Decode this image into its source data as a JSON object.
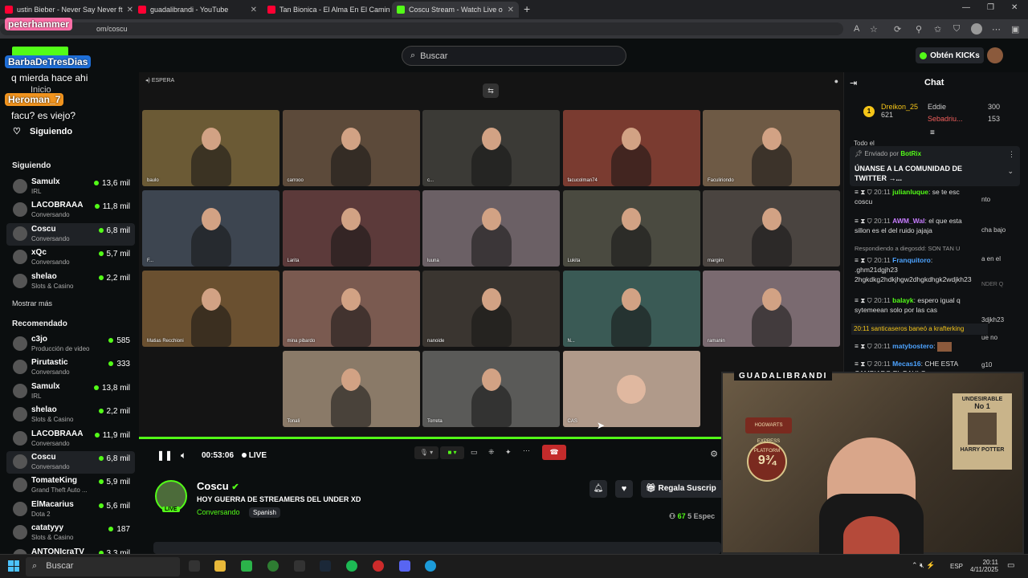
{
  "browser": {
    "tabs": [
      {
        "title": "ustin Bieber - Never Say Never ft",
        "color": "#ff0033"
      },
      {
        "title": "guadalibrandi - YouTube",
        "color": "#ff0033"
      },
      {
        "title": "Tan Bionica - El Alma En El Camin",
        "color": "#ff0033"
      },
      {
        "title": "Coscu Stream - Watch Live o",
        "color": "#53fc18"
      }
    ],
    "url": "om/coscu"
  },
  "header": {
    "search_placeholder": "Buscar",
    "get_kicks": "Obtén KICKs"
  },
  "overlay_chat": {
    "user1": "peterhammer",
    "user2": "BarbaDeTresDias",
    "msg1": "q mierda hace ahi",
    "user3": "Heroman_7",
    "msg2": "facu? es viejo?"
  },
  "sidebar": {
    "home": "Inicio",
    "following_link": "Siguiendo",
    "following_title": "Siguiendo",
    "following": [
      {
        "name": "Samulx",
        "sub": "IRL",
        "viewers": "13,6 mil"
      },
      {
        "name": "LACOBRAAA",
        "sub": "Conversando",
        "viewers": "11,8 mil"
      },
      {
        "name": "Coscu",
        "sub": "Conversando",
        "viewers": "6,8 mil"
      },
      {
        "name": "xQc",
        "sub": "Conversando",
        "viewers": "5,7 mil"
      },
      {
        "name": "shelao",
        "sub": "Slots & Casino",
        "viewers": "2,2 mil"
      }
    ],
    "show_more": "Mostrar más",
    "recommended_title": "Recomendado",
    "recommended": [
      {
        "name": "c3jo",
        "sub": "Producción de video",
        "viewers": "585"
      },
      {
        "name": "Pirutastic",
        "sub": "Conversando",
        "viewers": "333"
      },
      {
        "name": "Samulx",
        "sub": "IRL",
        "viewers": "13,8 mil"
      },
      {
        "name": "shelao",
        "sub": "Slots & Casino",
        "viewers": "2,2 mil"
      },
      {
        "name": "LACOBRAAA",
        "sub": "Conversando",
        "viewers": "11,9 mil"
      },
      {
        "name": "Coscu",
        "sub": "Conversando",
        "viewers": "6,8 mil"
      },
      {
        "name": "TomateKing",
        "sub": "Grand Theft Auto ...",
        "viewers": "5,9 mil"
      },
      {
        "name": "ElMacarius",
        "sub": "Dota 2",
        "viewers": "5,6 mil"
      },
      {
        "name": "catatyyy",
        "sub": "Slots & Casino",
        "viewers": "187"
      },
      {
        "name": "ANTONIcraTV",
        "sub": "",
        "viewers": "3,3 mil"
      }
    ]
  },
  "video": {
    "status": "ESPERA",
    "participants": [
      "baulo",
      "carrooo",
      "c...",
      "facucolman74",
      "Faculiriondo",
      "F...",
      "Larita",
      "luuna",
      "Lukita",
      "margim",
      "Matias Recchioni",
      "mina pibardo",
      "nanoide",
      "N...",
      "ramanin",
      "Tonali",
      "Torreta",
      "CAS"
    ],
    "time": "00:53:06",
    "live": "LIVE"
  },
  "channel": {
    "name": "Coscu",
    "title": "HOY GUERRA DE STREAMERS DEL UNDER XD",
    "category": "Conversando",
    "language": "Spanish",
    "live_badge": "LIVE",
    "gift_button": "Regala Suscrip",
    "viewers": "67",
    "espect": "5 Espec"
  },
  "chat": {
    "title": "Chat",
    "leaderboard": [
      {
        "name": "Dreikon_25",
        "value": "621"
      },
      {
        "name": "Eddie",
        "value": "300"
      },
      {
        "name": "Sebadriu...",
        "value": "153"
      }
    ],
    "top_label": "Todo el ",
    "pinned_by_label": "Enviado por",
    "pinned_by": "BotRix",
    "pinned_text": "ÚNANSE A LA COMUNIDAD DE TWITTER →...",
    "messages": [
      {
        "time": "20:11",
        "user": "julianluque",
        "text": "se te esc",
        "extra": "coscu"
      },
      {
        "time": "20:11",
        "user": "AWM_Wal",
        "text": "el que esta",
        "extra": "sillon es el del ruido jajaja"
      },
      {
        "reply": "Respondiendo a diegosdd: SON TAN U"
      },
      {
        "time": "20:11",
        "user": "Franquitoro",
        "text": "",
        "extra": ".ghm21dgjh23 2hgkdkg2hdkjhgw2dhgkdhgk2wdjkh23"
      },
      {
        "time": "20:11",
        "user": "balayk",
        "text": "espero igual q",
        "extra": "sytemeean solo por las cas"
      },
      {
        "ban": "20:11 santicaseros baneó a krafterking"
      },
      {
        "time": "20:11",
        "user": "matybostero",
        "text": ""
      },
      {
        "time": "20:11",
        "user": "Mecas16",
        "text": "CHE ESTA",
        "extra": "CAMBIADO EL BAULO"
      }
    ],
    "fragments": [
      "nto",
      "cha bajo",
      "a en el",
      "NDER Q",
      "3djkh23",
      "ue no",
      "g10"
    ]
  },
  "webcam": {
    "label": "GUADALIBRANDI",
    "poster1": "UNDESIRABLE",
    "poster2": "No 1",
    "poster3": "HARRY POTTER",
    "sign1": "HOGWARTS EXPRESS",
    "sign2": "PLATFORM",
    "sign3": "9¾"
  },
  "taskbar": {
    "search": "Buscar",
    "lang": "ESP",
    "time": "20:11",
    "date": "4/11/2025"
  }
}
